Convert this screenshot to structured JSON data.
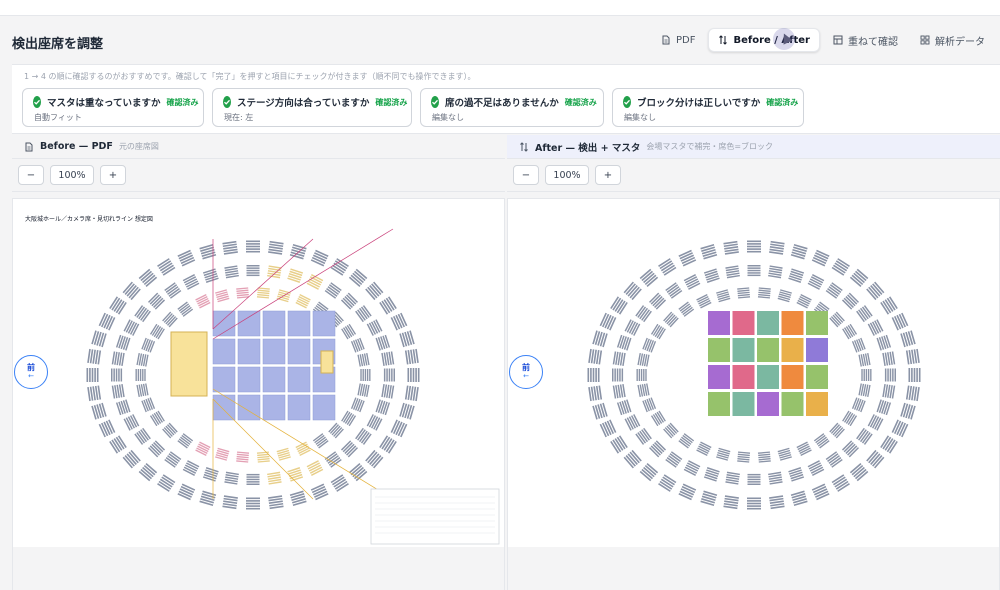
{
  "header": {
    "title": "検出座席を調整",
    "tabs": [
      {
        "label": "PDF",
        "icon": "file-icon"
      },
      {
        "label": "Before / After",
        "icon": "swap-icon",
        "active": true
      },
      {
        "label": "重ねて確認",
        "icon": "layers-icon"
      },
      {
        "label": "解析データ",
        "icon": "grid-icon"
      }
    ]
  },
  "checklist": {
    "hint": "1 → 4 の順に確認するのがおすすめです。確認して「完了」を押すと項目にチェックが付きます（順不同でも操作できます）。",
    "items": [
      {
        "title": "マスタは重なっていますか",
        "badge": "確認済み",
        "sub": "自動フィット"
      },
      {
        "title": "ステージ方向は合っていますか",
        "badge": "確認済み",
        "sub": "現在: 左"
      },
      {
        "title": "席の過不足はありませんか",
        "badge": "確認済み",
        "sub": "編集なし"
      },
      {
        "title": "ブロック分けは正しいですか",
        "badge": "確認済み",
        "sub": "編集なし"
      }
    ]
  },
  "before": {
    "title": "Before — PDF",
    "sub": "元の座席図",
    "zoom": "100%",
    "minus": "−",
    "plus": "+",
    "front": "前",
    "front_arrow": "←"
  },
  "after": {
    "title": "After — 検出 + マスタ",
    "sub": "会場マスタで補完・席色=ブロック",
    "zoom": "100%",
    "minus": "−",
    "plus": "+",
    "front": "前",
    "front_arrow": "←"
  },
  "colors": {
    "accent": "#22a04a",
    "front_ring": "#3b82f6",
    "seat_gray": "#8a93a6",
    "floor_blue": "#aab4e6",
    "stage_yellow": "#f8e29a",
    "block_colors": [
      "#a66bd1",
      "#e0698a",
      "#7bb8a1",
      "#ef8a3e",
      "#96c26b",
      "#e9b04a",
      "#8f7ad8"
    ]
  }
}
